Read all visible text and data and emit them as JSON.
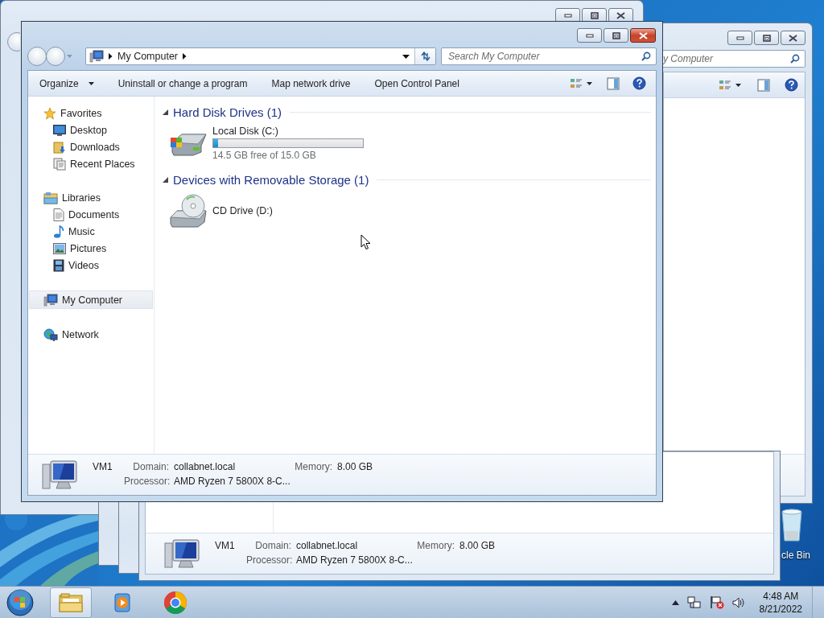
{
  "desktop": {
    "icons": [
      {
        "label": "cle Bin"
      }
    ]
  },
  "right_window": {
    "search": {
      "placeholder": "y Computer"
    }
  },
  "bottom_window": {
    "details": {
      "name": "VM1",
      "fields": [
        {
          "label": "Domain:",
          "value": "collabnet.local"
        },
        {
          "label": "Processor:",
          "value": "AMD Ryzen 7 5800X 8-C..."
        },
        {
          "label": "Memory:",
          "value": "8.00 GB"
        }
      ]
    }
  },
  "main_window": {
    "address": {
      "crumbs": [
        "My Computer"
      ]
    },
    "search": {
      "placeholder": "Search My Computer"
    },
    "toolbar": {
      "commands": [
        {
          "label": "Organize",
          "dropdown": true
        },
        {
          "label": "Uninstall or change a program",
          "dropdown": false
        },
        {
          "label": "Map network drive",
          "dropdown": false
        },
        {
          "label": "Open Control Panel",
          "dropdown": false
        }
      ]
    },
    "sidebar": {
      "groups": [
        {
          "label": "Favorites",
          "kind": "star",
          "selected": false,
          "children": [
            {
              "label": "Desktop",
              "kind": "desktop",
              "selected": false
            },
            {
              "label": "Downloads",
              "kind": "downloads",
              "selected": false
            },
            {
              "label": "Recent Places",
              "kind": "recent",
              "selected": false
            }
          ]
        },
        {
          "label": "Libraries",
          "kind": "libraries",
          "selected": false,
          "children": [
            {
              "label": "Documents",
              "kind": "documents",
              "selected": false
            },
            {
              "label": "Music",
              "kind": "music",
              "selected": false
            },
            {
              "label": "Pictures",
              "kind": "pictures",
              "selected": false
            },
            {
              "label": "Videos",
              "kind": "videos",
              "selected": false
            }
          ]
        },
        {
          "label": "My Computer",
          "kind": "computer",
          "selected": true
        },
        {
          "label": "Network",
          "kind": "network",
          "selected": false
        }
      ]
    },
    "groups": [
      {
        "title": "Hard Disk Drives (1)",
        "expanded": true,
        "drives": [
          {
            "name": "Local Disk (C:)",
            "kind": "hdd",
            "level": 0.033,
            "free": "14.5 GB free of 15.0 GB"
          }
        ]
      },
      {
        "title": "Devices with Removable Storage (1)",
        "expanded": true,
        "drives": [
          {
            "name": "CD Drive (D:)",
            "kind": "cd"
          }
        ]
      }
    ],
    "details": {
      "name": "VM1",
      "fields": [
        {
          "label": "Domain:",
          "value": "collabnet.local"
        },
        {
          "label": "Processor:",
          "value": "AMD Ryzen 7 5800X 8-C..."
        },
        {
          "label": "Memory:",
          "value": "8.00 GB"
        }
      ]
    }
  },
  "taskbar": {
    "apps": [
      {
        "kind": "explorer",
        "selected": true
      },
      {
        "kind": "media",
        "selected": false
      },
      {
        "kind": "chrome",
        "selected": false
      }
    ],
    "clock": {
      "time": "4:48 AM",
      "date": "8/21/2022"
    }
  }
}
